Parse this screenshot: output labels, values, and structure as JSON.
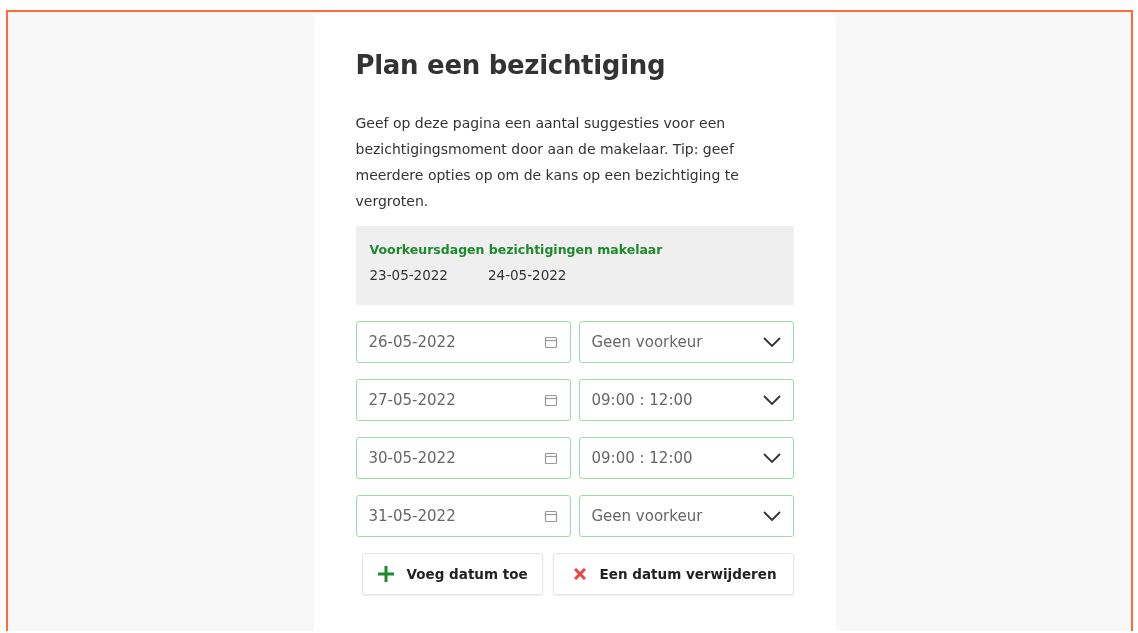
{
  "title": "Plan een bezichtiging",
  "intro": "Geef op deze pagina een aantal suggesties voor een bezichtigingsmoment door aan de makelaar. Tip: geef meerdere opties op om de kans op een bezichtiging te vergroten.",
  "preferred_days": {
    "heading": "Voorkeursdagen bezichtigingen makelaar",
    "dates": [
      "23-05-2022",
      "24-05-2022"
    ]
  },
  "rows": [
    {
      "date": "26-05-2022",
      "time": "Geen voorkeur"
    },
    {
      "date": "27-05-2022",
      "time": "09:00 : 12:00"
    },
    {
      "date": "30-05-2022",
      "time": "09:00 : 12:00"
    },
    {
      "date": "31-05-2022",
      "time": "Geen voorkeur"
    }
  ],
  "buttons": [
    {
      "kind": "add",
      "label": "Voeg datum toe"
    },
    {
      "kind": "remove",
      "label": "Een datum verwijderen"
    }
  ]
}
